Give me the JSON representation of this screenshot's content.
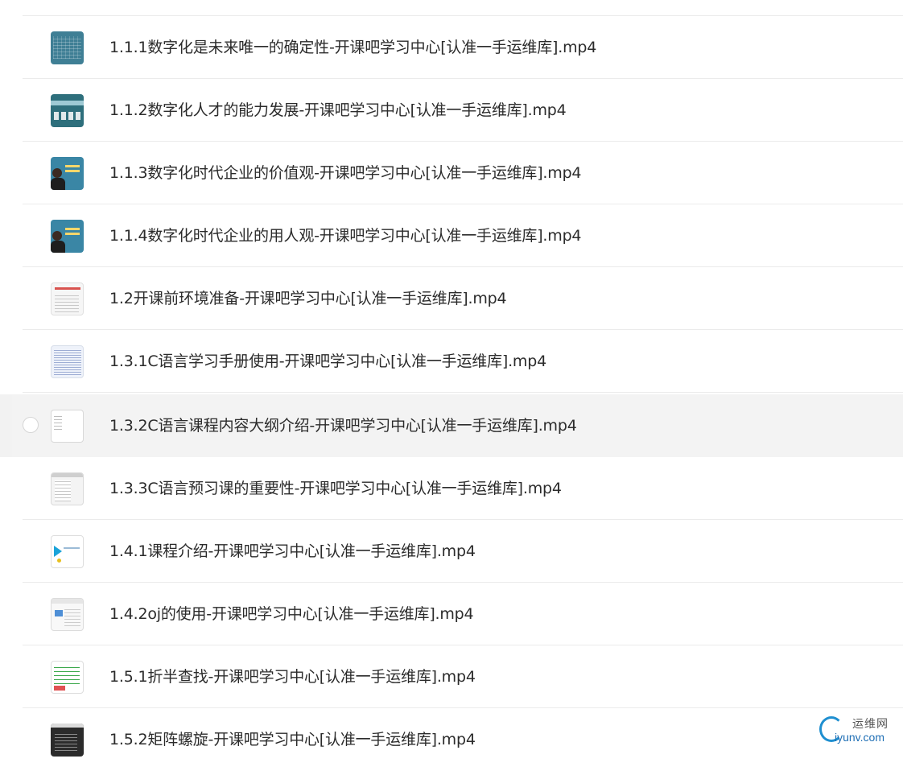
{
  "files": [
    {
      "name": "1.1.1数字化是未来唯一的确定性-开课吧学习中心[认准一手运维库].mp4",
      "thumb": "teal-grid"
    },
    {
      "name": "1.1.2数字化人才的能力发展-开课吧学习中心[认准一手运维库].mp4",
      "thumb": "banner"
    },
    {
      "name": "1.1.3数字化时代企业的价值观-开课吧学习中心[认准一手运维库].mp4",
      "thumb": "person"
    },
    {
      "name": "1.1.4数字化时代企业的用人观-开课吧学习中心[认准一手运维库].mp4",
      "thumb": "person"
    },
    {
      "name": "1.2开课前环境准备-开课吧学习中心[认准一手运维库].mp4",
      "thumb": "document"
    },
    {
      "name": "1.3.1C语言学习手册使用-开课吧学习中心[认准一手运维库].mp4",
      "thumb": "list"
    },
    {
      "name": "1.3.2C语言课程内容大纲介绍-开课吧学习中心[认准一手运维库].mp4",
      "thumb": "blank",
      "hovered": true
    },
    {
      "name": "1.3.3C语言预习课的重要性-开课吧学习中心[认准一手运维库].mp4",
      "thumb": "ui"
    },
    {
      "name": "1.4.1课程介绍-开课吧学习中心[认准一手运维库].mp4",
      "thumb": "play"
    },
    {
      "name": "1.4.2oj的使用-开课吧学习中心[认准一手运维库].mp4",
      "thumb": "oj"
    },
    {
      "name": "1.5.1折半查找-开课吧学习中心[认准一手运维库].mp4",
      "thumb": "code"
    },
    {
      "name": "1.5.2矩阵螺旋-开课吧学习中心[认准一手运维库].mp4",
      "thumb": "dark"
    }
  ],
  "watermark": {
    "cn": "运维网",
    "en": "iyunv.com"
  },
  "colors": {
    "text": "#2b2b2b",
    "divider": "#ebebeb",
    "hover": "#f2f2f2",
    "watermark_blue": "#1f8fd0"
  }
}
